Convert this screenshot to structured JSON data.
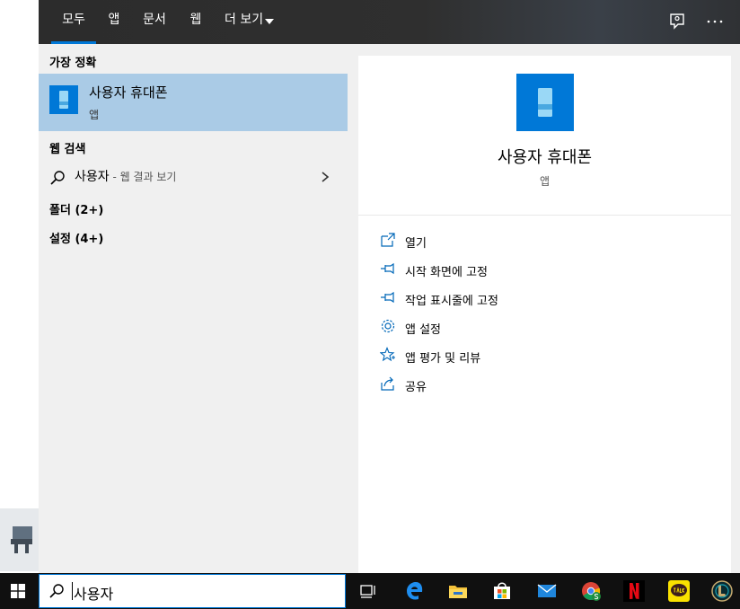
{
  "tabs": [
    {
      "label": "모두",
      "active": true
    },
    {
      "label": "앱",
      "active": false
    },
    {
      "label": "문서",
      "active": false
    },
    {
      "label": "웹",
      "active": false
    },
    {
      "label": "더 보기",
      "active": false
    }
  ],
  "sections": {
    "best_match": "가장 정확",
    "web_search": "웹 검색",
    "folders": "폴더 (2+)",
    "settings": "설정 (4+)"
  },
  "best_match": {
    "title": "사용자 휴대폰",
    "subtitle": "앱"
  },
  "web_result": {
    "query": "사용자",
    "suffix": " - 웹 결과 보기"
  },
  "detail": {
    "title": "사용자 휴대폰",
    "subtitle": "앱"
  },
  "actions": [
    {
      "label": "열기",
      "icon": "open-icon"
    },
    {
      "label": "시작 화면에 고정",
      "icon": "pin-icon"
    },
    {
      "label": "작업 표시줄에 고정",
      "icon": "pin-icon"
    },
    {
      "label": "앱 설정",
      "icon": "gear-icon"
    },
    {
      "label": "앱 평가 및 리뷰",
      "icon": "star-icon"
    },
    {
      "label": "공유",
      "icon": "share-icon"
    }
  ],
  "search": {
    "value": "사용자"
  },
  "colors": {
    "accent": "#0078d7",
    "highlight": "#aacbe6"
  }
}
